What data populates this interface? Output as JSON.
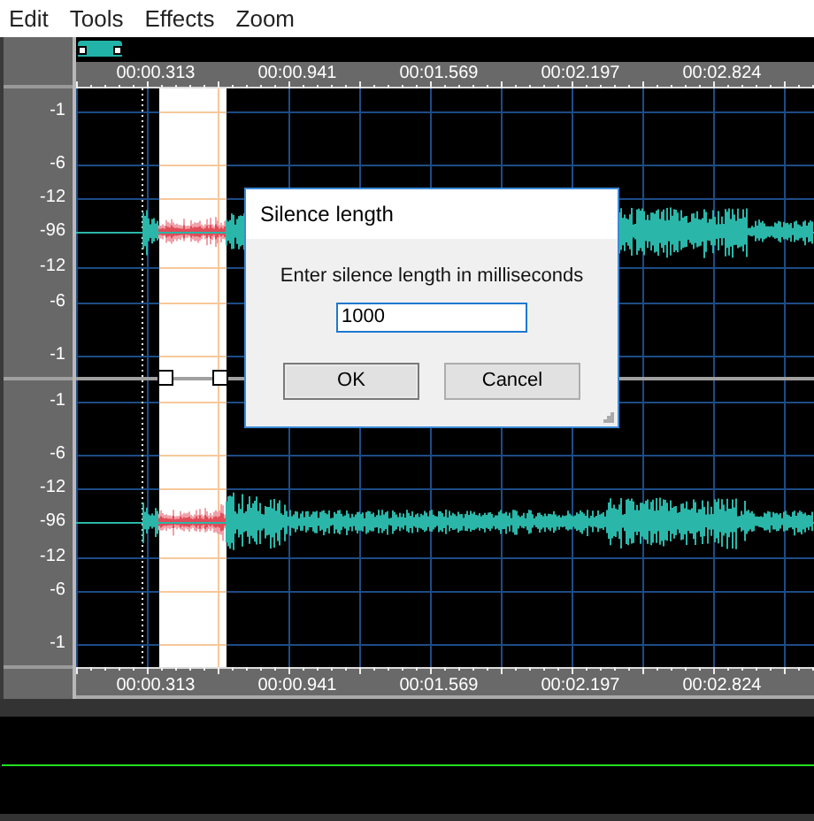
{
  "menu": [
    "Edit",
    "Tools",
    "Effects",
    "Zoom"
  ],
  "ruler_top": [
    "00:00.313",
    "00:00.941",
    "00:01.569",
    "00:02.197",
    "00:02.824"
  ],
  "channels": [
    {
      "scale": [
        "-1",
        "-6",
        "-12",
        "-96",
        "-12",
        "-6",
        "-1"
      ]
    },
    {
      "scale": [
        "-1",
        "-6",
        "-12",
        "-96",
        "-12",
        "-6",
        "-1"
      ]
    }
  ],
  "ruler_bottom": [
    "00:00.313",
    "00:00.941",
    "00:01.569",
    "00:02.197",
    "00:02.824"
  ],
  "dialog": {
    "title": "Silence length",
    "prompt": "Enter silence length in milliseconds",
    "input": {
      "value": "1000"
    },
    "buttons": [
      {
        "label": "OK",
        "kind": "default"
      },
      {
        "label": "Cancel",
        "kind": "normal"
      }
    ]
  }
}
